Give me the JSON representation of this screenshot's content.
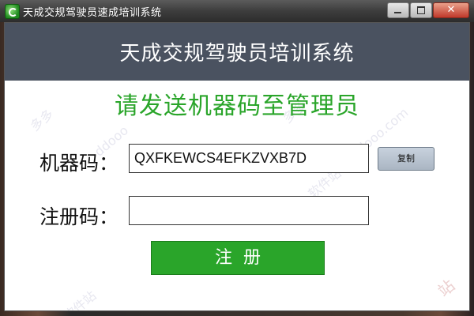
{
  "window": {
    "title": "天成交规驾驶员速成培训系统",
    "controls": [
      "minimize-icon",
      "maximize-icon",
      "close-icon"
    ],
    "close_glyph": "✕"
  },
  "banner": {
    "title": "天成交规驾驶员培训系统"
  },
  "instruction": "请发送机器码至管理员",
  "machine_code": {
    "label": "机器码：",
    "value": "QXFKEWCS4EFKZVXB7D",
    "copy_label": "复制"
  },
  "registration_code": {
    "label": "注册码：",
    "value": "",
    "placeholder": ""
  },
  "register_button": {
    "label": "注册"
  },
  "colors": {
    "accent_green": "#2aa52a",
    "banner_bg": "#4a5260",
    "copy_button": "#b5c0cc"
  }
}
